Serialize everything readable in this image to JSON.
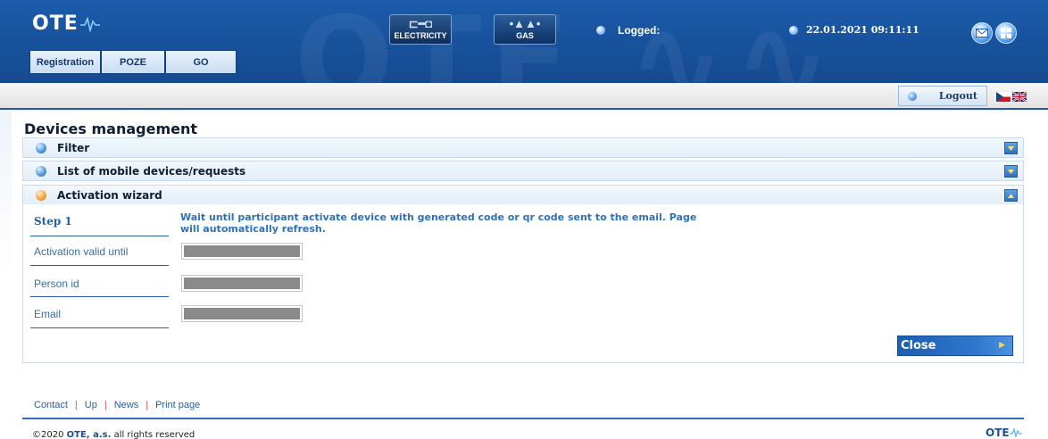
{
  "header": {
    "logo_text": "OTE",
    "tabs": [
      {
        "label": "Registration"
      },
      {
        "label": "POZE"
      },
      {
        "label": "GO"
      }
    ],
    "commodities": [
      {
        "label": "ELECTRICITY",
        "icon": "plug-icon"
      },
      {
        "label": "GAS",
        "icon": "gas-flame-icon"
      }
    ],
    "logged_label": "Logged:",
    "datetime": "22.01.2021 09:11:11",
    "icons": {
      "mail": "mail-icon",
      "home": "home-icon"
    }
  },
  "toolbar": {
    "logout_label": "Logout",
    "languages": [
      "cz-flag-icon",
      "gb-flag-icon"
    ]
  },
  "page": {
    "title": "Devices management",
    "panels": [
      {
        "title": "Filter",
        "state": "collapsed"
      },
      {
        "title": "List of mobile devices/requests",
        "state": "collapsed"
      },
      {
        "title": "Activation wizard",
        "state": "expanded"
      }
    ]
  },
  "wizard": {
    "step_label": "Step 1",
    "message": "Wait until participant activate device with generated code or qr code sent to the email. Page will automatically refresh.",
    "fields": [
      {
        "label": "Activation valid until",
        "value": ""
      },
      {
        "label": "Person id",
        "value": ""
      },
      {
        "label": "Email",
        "value": ""
      }
    ],
    "close_label": "Close"
  },
  "footer": {
    "links": [
      "Contact",
      "Up",
      "News",
      "Print page"
    ],
    "separator": "|",
    "copyright_prefix": "©2020",
    "copyright_company": "OTE, a.s.",
    "copyright_suffix": "all rights reserved",
    "logo_text": "OTE"
  },
  "colors": {
    "header_blue": "#18519c",
    "panel_bg": "#e3eef8",
    "link_blue": "#2a5d9c",
    "close_button": "#2f78cf",
    "active_ball": "#f7a640"
  }
}
